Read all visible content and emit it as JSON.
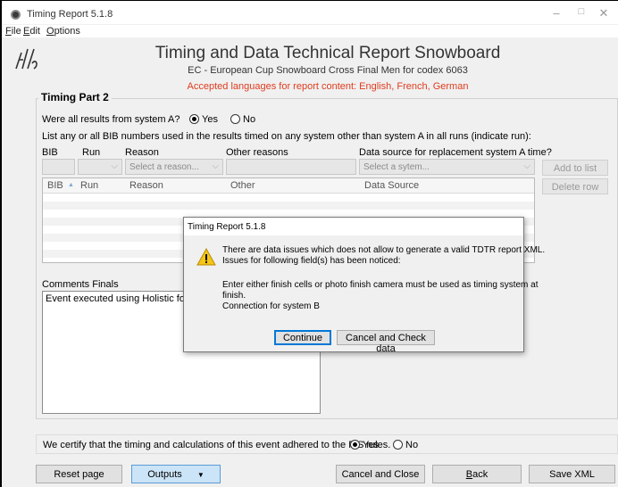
{
  "window": {
    "title": "Timing Report 5.1.8",
    "controls": {
      "minimize": "–",
      "maximize": "□",
      "close": "✕"
    }
  },
  "menu": {
    "file": {
      "key": "F",
      "rest": "ile"
    },
    "edit": {
      "key": "E",
      "rest": "dit"
    },
    "options": {
      "key": "O",
      "rest": "ptions"
    }
  },
  "header": {
    "title": "Timing and Data Technical Report Snowboard",
    "subtitle": "EC - European Cup Snowboard Cross Final Men for codex 6063",
    "languages": "Accepted languages for report content: English, French, German"
  },
  "timing_part": {
    "group_label": "Timing Part 2",
    "question": "Were all results from system A?",
    "yes_label": "Yes",
    "no_label": "No",
    "selected": "yes",
    "instructions": "List any or all BIB numbers used in the results timed on any system other than system A in all runs (indicate run):",
    "labels": {
      "bib": "BIB",
      "run": "Run",
      "reason": "Reason",
      "other_reasons": "Other reasons",
      "data_source": "Data source for replacement system A time?"
    },
    "reason_placeholder": "Select a reason...",
    "source_placeholder": "Select a sytem...",
    "add_button": "Add to list",
    "delete_button": "Delete row",
    "table_headers": [
      "BIB",
      "Run",
      "Reason",
      "Other",
      "Data Source"
    ],
    "sort_indicator": "▲"
  },
  "comments": {
    "label": "Comments Finals",
    "text": "Event executed using Holistic format"
  },
  "certify": {
    "text": "We certify that the timing and calculations of this event adhered to the FIS rules.",
    "yes_label": "Yes",
    "no_label": "No",
    "selected": "yes"
  },
  "footer": {
    "reset": "Reset page",
    "outputs": "Outputs",
    "outputs_arrow": "▼",
    "cancel_close": "Cancel and Close",
    "back_key": "B",
    "back_rest": "ack",
    "save_xml": "Save XML"
  },
  "dialog": {
    "title": "Timing Report 5.1.8",
    "line1": "There are data issues which does not allow to generate a valid TDTR report XML.",
    "line2": "Issues for following field(s) has been noticed:",
    "line3": "Enter either finish cells or photo finish camera must be used as timing system at",
    "line4": "finish.",
    "line5": "Connection for system B",
    "continue_button": "Continue",
    "cancel_check_button": "Cancel and Check data",
    "icon": "warning-icon"
  },
  "colors": {
    "accent_red": "#e03c1e",
    "button_blue": "#cce4f7",
    "warning_yellow": "#f5c518"
  }
}
